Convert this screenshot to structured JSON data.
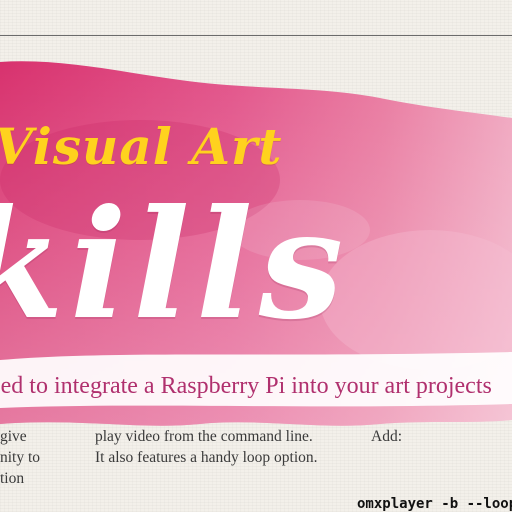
{
  "article": {
    "kicker": "Visual Art",
    "headline": "kills",
    "strap": "eed to integrate a Raspberry Pi into your art projects",
    "columns": [
      {
        "lines": [
          "give",
          "nity to",
          "tion"
        ]
      },
      {
        "lines": [
          "play video from the command line.",
          "It also features a handy loop option."
        ]
      },
      {
        "lines": [
          "Add:"
        ]
      }
    ],
    "code": "omxplayer -b --loop"
  },
  "colors": {
    "kicker": "#ffd21e",
    "headline": "#ffffff",
    "strap": "#b0306e",
    "wash": "#e0427e",
    "body_text": "#3a3a3a"
  }
}
